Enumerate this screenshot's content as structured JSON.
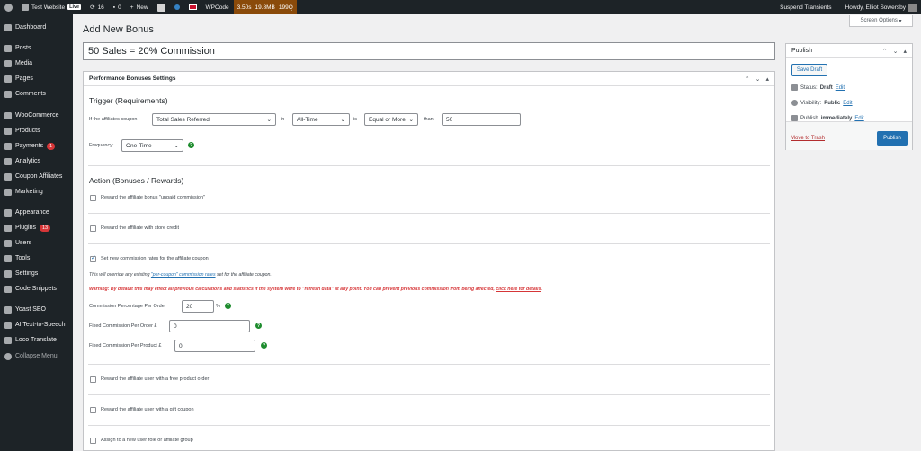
{
  "adminbar": {
    "site_name": "Test Website",
    "live_label": "Live",
    "updates_count": "16",
    "comments_count": "0",
    "new_label": "New",
    "wpcode_label": "WPCode",
    "perf_time": "3.50s",
    "perf_mem": "19.8MB",
    "perf_q": "199Q",
    "suspend_label": "Suspend Transients",
    "howdy": "Howdy, Elliot Sowersby"
  },
  "sidebar": {
    "items": [
      {
        "label": "Dashboard",
        "icon": "dashboard-icon"
      },
      {
        "label": "Posts",
        "icon": "pin-icon"
      },
      {
        "label": "Media",
        "icon": "media-icon"
      },
      {
        "label": "Pages",
        "icon": "pages-icon"
      },
      {
        "label": "Comments",
        "icon": "comments-icon"
      },
      {
        "label": "WooCommerce",
        "icon": "woocommerce-icon"
      },
      {
        "label": "Products",
        "icon": "products-icon"
      },
      {
        "label": "Payments",
        "icon": "payments-icon",
        "badge": "1"
      },
      {
        "label": "Analytics",
        "icon": "analytics-icon"
      },
      {
        "label": "Coupon Affiliates",
        "icon": "coupon-icon"
      },
      {
        "label": "Marketing",
        "icon": "marketing-icon"
      },
      {
        "label": "Appearance",
        "icon": "appearance-icon"
      },
      {
        "label": "Plugins",
        "icon": "plugins-icon",
        "badge": "13"
      },
      {
        "label": "Users",
        "icon": "users-icon"
      },
      {
        "label": "Tools",
        "icon": "tools-icon"
      },
      {
        "label": "Settings",
        "icon": "settings-icon"
      },
      {
        "label": "Code Snippets",
        "icon": "snippets-icon"
      },
      {
        "label": "Yoast SEO",
        "icon": "yoast-icon"
      },
      {
        "label": "AI Text-to-Speech",
        "icon": "speech-icon"
      },
      {
        "label": "Loco Translate",
        "icon": "translate-icon"
      },
      {
        "label": "Collapse Menu",
        "icon": "collapse-icon"
      }
    ]
  },
  "screen_options": "Screen Options",
  "page_title": "Add New Bonus",
  "bonus_title": "50 Sales = 20% Commission",
  "metabox": {
    "title": "Performance Bonuses Settings",
    "trigger_heading": "Trigger (Requirements)",
    "if_label": "If the affiliates coupon",
    "metric_select": "Total Sales Referred",
    "in_label": "in",
    "period_select": "All-Time",
    "is_label": "is",
    "compare_select": "Equal or More",
    "than_label": "than",
    "threshold_value": "50",
    "frequency_label": "Frequency:",
    "frequency_select": "One-Time",
    "action_heading": "Action (Bonuses / Rewards)",
    "reward_unpaid": "Reward the affiliate bonus \"unpaid commission\"",
    "reward_store_credit": "Reward the affiliate with store credit",
    "set_rates": "Set new commission rates for the affiliate coupon",
    "override_note_pre": "This will override any existing ",
    "override_note_link": "\"per-coupon\" commission rates",
    "override_note_post": " set for the affiliate coupon.",
    "warning_text": "Warning: By default this may effect all previous calculations and statistics if the system were to \"refresh data\" at any point. You can prevent previous commission from being affected, ",
    "warning_link": "click here for details",
    "warning_end": ".",
    "pct_label": "Commission Percentage Per Order",
    "pct_value": "20",
    "pct_unit": "%",
    "fixed_order_label": "Fixed Commission Per Order £",
    "fixed_order_value": "0",
    "fixed_product_label": "Fixed Commission Per Product £",
    "fixed_product_value": "0",
    "reward_free_product": "Reward the affiliate user with a free product order",
    "reward_gift_coupon": "Reward the affiliate user with a gift coupon",
    "assign_role": "Assign to a new user role or affiliate group"
  },
  "publish": {
    "title": "Publish",
    "save_draft": "Save Draft",
    "status_label": "Status: ",
    "status_value": "Draft",
    "visibility_label": "Visibility: ",
    "visibility_value": "Public",
    "publish_label": "Publish ",
    "publish_value": "immediately",
    "edit": "Edit",
    "trash": "Move to Trash",
    "publish_button": "Publish"
  }
}
